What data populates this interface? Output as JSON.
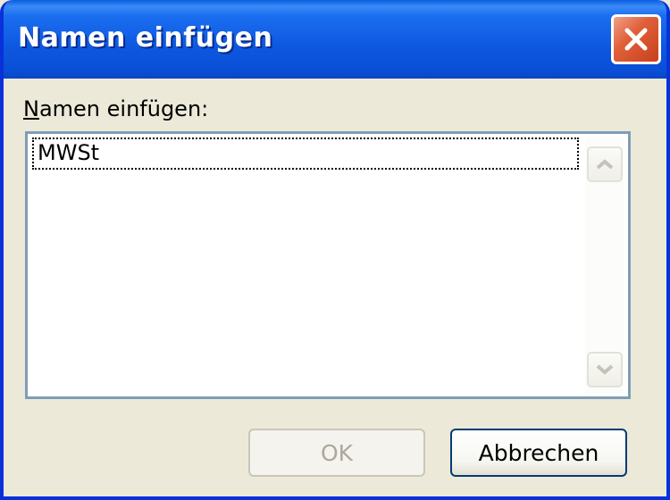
{
  "window": {
    "title": "Namen einfügen"
  },
  "dialog": {
    "label_mnemonic": "N",
    "label_rest": "amen einfügen:",
    "list_items": [
      "MWSt"
    ]
  },
  "buttons": {
    "ok_label": "OK",
    "cancel_label": "Abbrechen"
  },
  "icons": {
    "close": "close-icon",
    "scroll_up": "chevron-up-icon",
    "scroll_down": "chevron-down-icon"
  },
  "colors": {
    "titlebar": "#0a5ddf",
    "close_button": "#e0603a",
    "dialog_background": "#ece9d8",
    "listbox_border": "#7f9db9",
    "default_button_border": "#003c74",
    "disabled_text": "#aca899"
  }
}
